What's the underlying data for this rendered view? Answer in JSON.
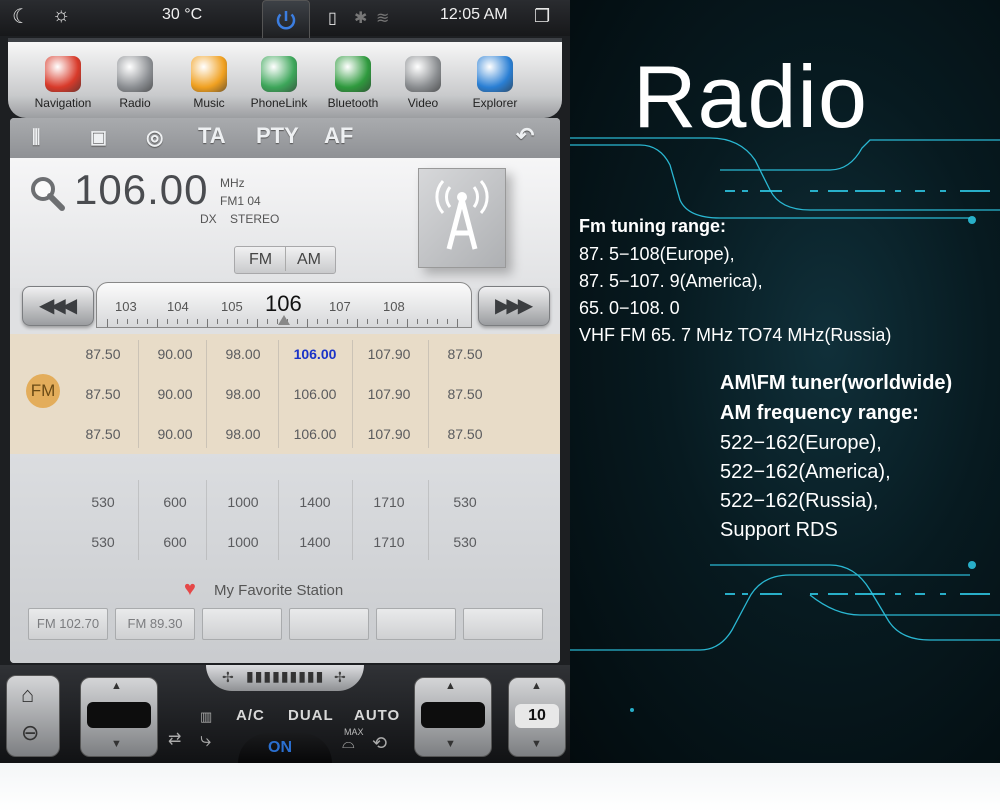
{
  "status_bar": {
    "temperature": "30 °C",
    "time": "12:05 AM"
  },
  "apps": [
    {
      "label": "Navigation",
      "icon": "navigation-icon",
      "color": "#d83a2a"
    },
    {
      "label": "Radio",
      "icon": "radio-icon",
      "color": "#8c8f93"
    },
    {
      "label": "Music",
      "icon": "music-icon",
      "color": "#f0a020"
    },
    {
      "label": "PhoneLink",
      "icon": "phonelink-icon",
      "color": "#3da65a"
    },
    {
      "label": "Bluetooth",
      "icon": "bluetooth-phone-icon",
      "color": "#2f9a3e"
    },
    {
      "label": "Video",
      "icon": "video-icon",
      "color": "#8a8d90"
    },
    {
      "label": "Explorer",
      "icon": "explorer-icon",
      "color": "#2a7fd4"
    }
  ],
  "toolbar": {
    "ta_label": "TA",
    "pty_label": "PTY",
    "af_label": "AF"
  },
  "frequency": {
    "value": "106.00",
    "unit": "MHz",
    "band_info": "FM1  04",
    "dx": "DX",
    "stereo": "STEREO"
  },
  "band_toggle": {
    "fm_label": "FM",
    "am_label": "AM",
    "selected": "FM"
  },
  "dial": {
    "ticks": [
      "103",
      "104",
      "105",
      "106",
      "107",
      "108"
    ],
    "current": "106"
  },
  "fm_badge": "FM",
  "fm_presets": [
    [
      "87.50",
      "90.00",
      "98.00",
      "106.00",
      "107.90",
      "87.50"
    ],
    [
      "87.50",
      "90.00",
      "98.00",
      "106.00",
      "107.90",
      "87.50"
    ],
    [
      "87.50",
      "90.00",
      "98.00",
      "106.00",
      "107.90",
      "87.50"
    ]
  ],
  "am_presets": [
    [
      "530",
      "600",
      "1000",
      "1400",
      "1710",
      "530"
    ],
    [
      "530",
      "600",
      "1000",
      "1400",
      "1710",
      "530"
    ]
  ],
  "favorites": {
    "title": "My Favorite Station",
    "stations": [
      "FM 102.70",
      "FM 89.30",
      "",
      "",
      "",
      ""
    ]
  },
  "climate": {
    "ac_label": "A/C",
    "dual_label": "DUAL",
    "auto_label": "AUTO",
    "on_label": "ON",
    "max_label": "MAX",
    "fan_level": "10"
  },
  "info": {
    "title": "Radio",
    "fm_heading": "Fm tuning range:",
    "fm_lines": [
      "87. 5−108(Europe),",
      "87. 5−107. 9(America),",
      "65. 0−108. 0",
      "VHF FM 65. 7 MHz TO74 MHz(Russia)"
    ],
    "am_heading_1": "AM\\FM tuner(worldwide)",
    "am_heading_2": "AM frequency range:",
    "am_lines": [
      "522−162(Europe),",
      "522−162(America),",
      "522−162(Russia),",
      "Support RDS"
    ]
  },
  "colors": {
    "accent_highlight": "#1a33c8",
    "fm_band": "#e8dcc8",
    "info_bg": "#071a20",
    "line_accent": "#2ec9e6"
  }
}
